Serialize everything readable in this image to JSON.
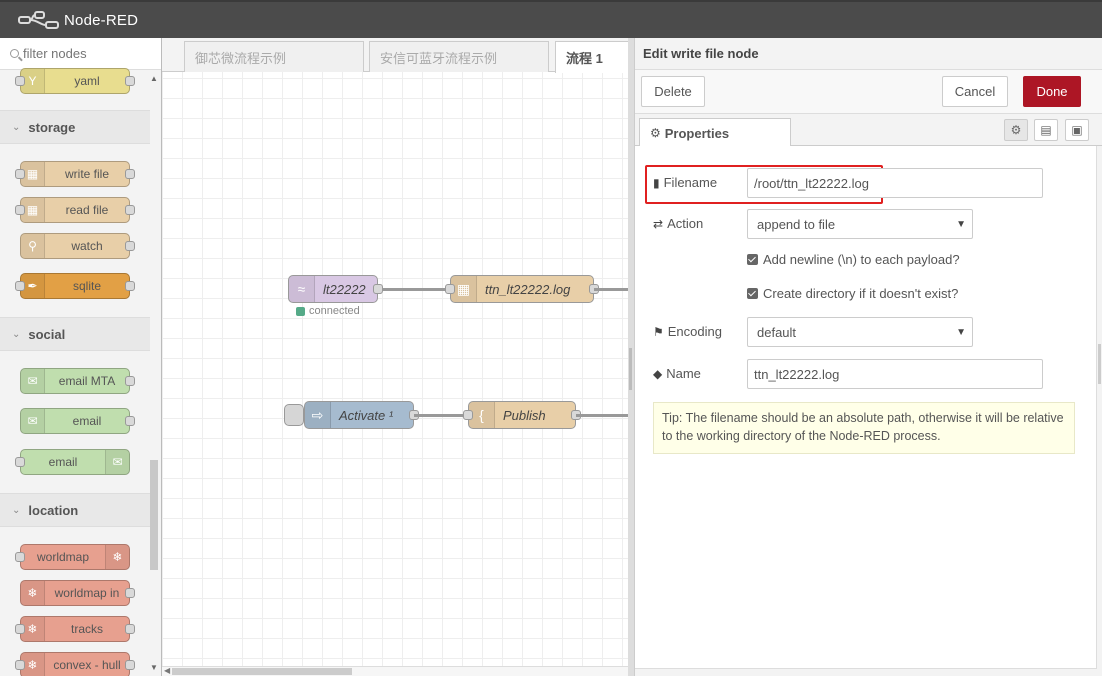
{
  "header": {
    "title": "Node-RED"
  },
  "palette": {
    "filter_placeholder": "filter nodes",
    "categories": {
      "storage": "storage",
      "social": "social",
      "location": "location"
    },
    "nodes": {
      "yaml": "yaml",
      "write_file": "write file",
      "read_file": "read file",
      "watch": "watch",
      "sqlite": "sqlite",
      "email_mta": "email MTA",
      "email_in": "email",
      "email_out": "email",
      "worldmap": "worldmap",
      "worldmap_in": "worldmap in",
      "tracks": "tracks",
      "convex_hull": "convex - hull"
    }
  },
  "workspace": {
    "tabs": [
      "御芯微流程示例",
      "安信可蓝牙流程示例",
      "流程 1"
    ],
    "nodes": {
      "mqtt_in": "lt22222",
      "mqtt_status": "connected",
      "file_out": "ttn_lt22222.log",
      "inject": "Activate ¹",
      "template": "Publish"
    }
  },
  "edit_panel": {
    "title": "Edit write file node",
    "delete_label": "Delete",
    "cancel_label": "Cancel",
    "done_label": "Done",
    "tab_properties": "Properties",
    "filename_label": "Filename",
    "filename_value": "/root/ttn_lt22222.log",
    "action_label": "Action",
    "action_value": "append to file",
    "newline_label": "Add newline (\\n) to each payload?",
    "createdir_label": "Create directory if it doesn't exist?",
    "encoding_label": "Encoding",
    "encoding_value": "default",
    "name_label": "Name",
    "name_value": "ttn_lt22222.log",
    "tip": "Tip: The filename should be an absolute path, otherwise it will be relative to the working directory of the Node-RED process."
  },
  "colors": {
    "header": "#4b4b4b",
    "done_button": "#ad1625",
    "highlight": "#e02020"
  }
}
